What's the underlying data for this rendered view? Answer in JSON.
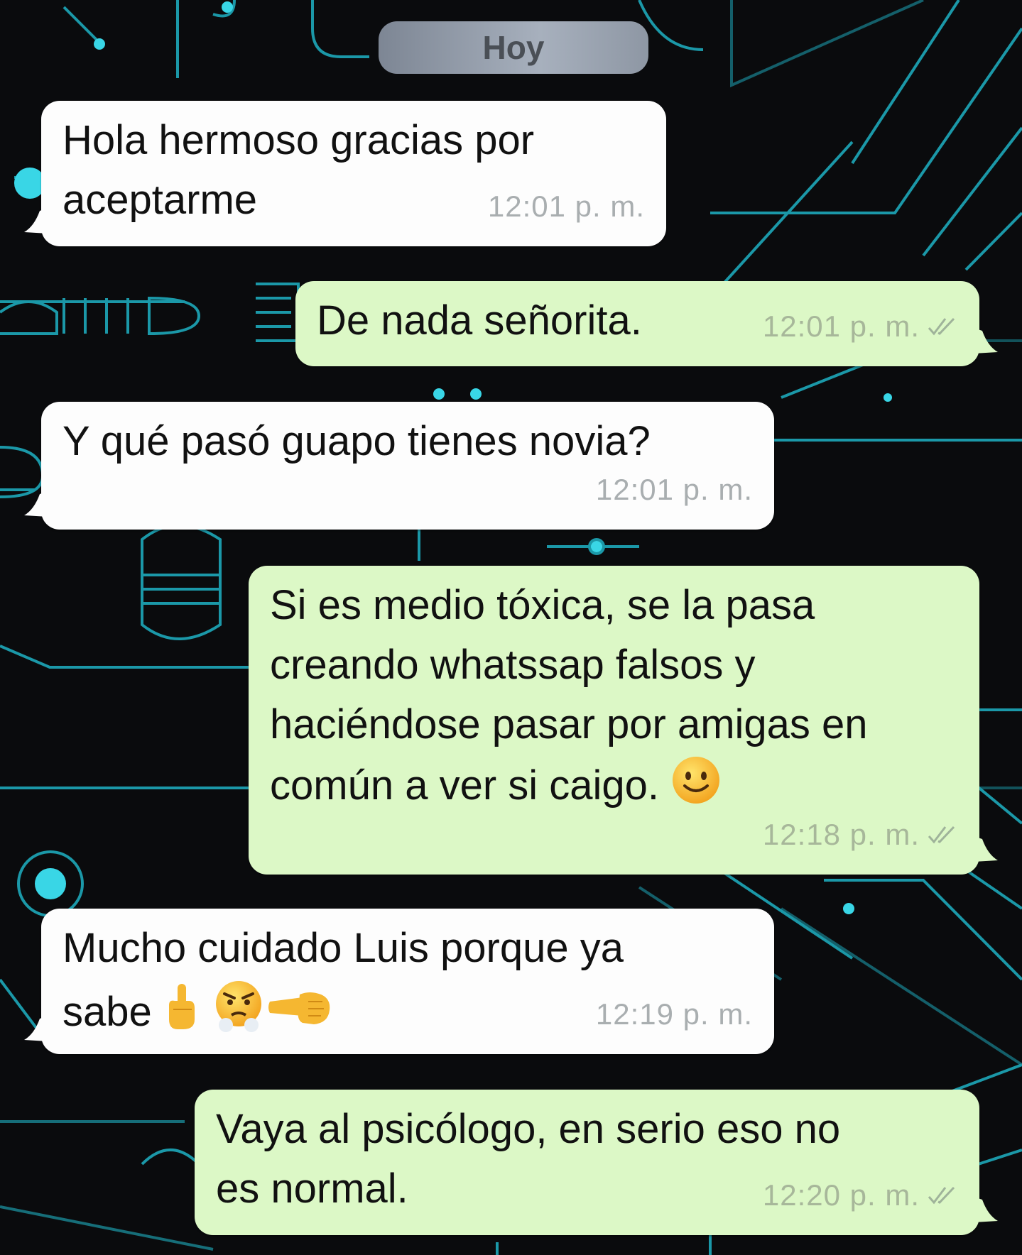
{
  "chat": {
    "date_label": "Hoy",
    "messages": [
      {
        "direction": "incoming",
        "text": "Hola hermoso gracias por\naceptarme",
        "time": "12:01 p. m."
      },
      {
        "direction": "outgoing",
        "text": "De nada señorita.",
        "time": "12:01 p. m.",
        "status": "read-double-check"
      },
      {
        "direction": "incoming",
        "text": "Y qué pasó guapo tienes novia?",
        "time": "12:01 p. m."
      },
      {
        "direction": "outgoing",
        "text": "Si es medio tóxica, se la pasa\ncreando whatssap falsos y\nhaciéndose pasar por amigas en\ncomún a ver si caigo.",
        "emojis": [
          "slightly-smiling-face"
        ],
        "time": "12:18 p. m.",
        "status": "read-double-check"
      },
      {
        "direction": "incoming",
        "text": "Mucho cuidado Luis porque ya\nsabe",
        "emojis": [
          "middle-finger",
          "face-with-steam-from-nose",
          "left-facing-fist"
        ],
        "time": "12:19 p. m."
      },
      {
        "direction": "outgoing",
        "text": "Vaya al psicólogo, en serio eso no\nes normal.",
        "time": "12:20 p. m.",
        "status": "read-double-check"
      }
    ]
  },
  "colors": {
    "incoming_bubble": "#fdfdfd",
    "outgoing_bubble": "#dcf8c6",
    "wallpaper_background": "#0a0b0d",
    "wallpaper_lines": "#25c6d6",
    "timestamp": "#a9aeb0"
  }
}
